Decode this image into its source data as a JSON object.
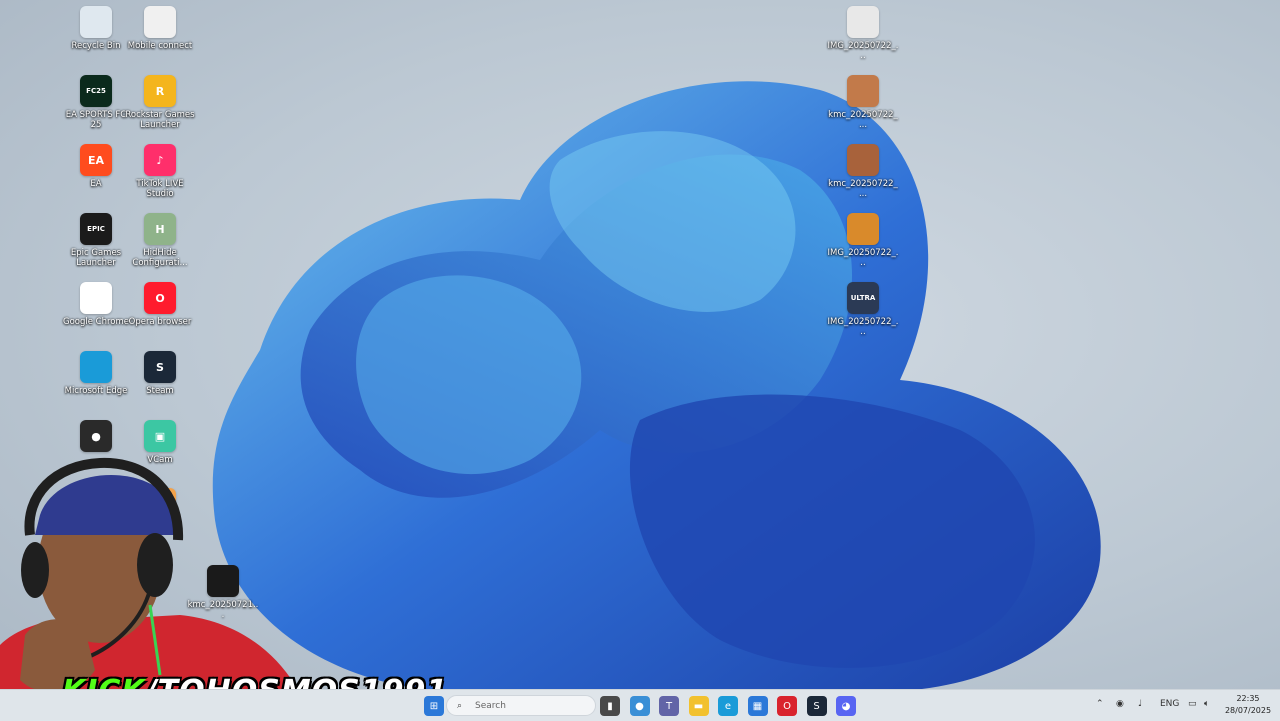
{
  "desktop": {
    "icons_left": [
      {
        "label": "Recycle Bin",
        "icon": "recycle-bin-icon",
        "color": "#dfe8ef"
      },
      {
        "label": "Mobile connect",
        "icon": "document-icon",
        "color": "#f0f0f0"
      },
      {
        "label": "EA SPORTS FC 25",
        "icon": "fc25-icon",
        "color": "#0b2a1c",
        "badge": "FC25"
      },
      {
        "label": "Rockstar Games Launcher",
        "icon": "rockstar-icon",
        "color": "#f4b51d",
        "badge": "R"
      },
      {
        "label": "EA",
        "icon": "ea-icon",
        "color": "#ff4c1e",
        "badge": "EA"
      },
      {
        "label": "TikTok LIVE Studio",
        "icon": "tiktok-live-icon",
        "color": "#ff2f6b",
        "badge": "♪"
      },
      {
        "label": "Epic Games Launcher",
        "icon": "epic-games-icon",
        "color": "#1b1b1b",
        "badge": "EPIC"
      },
      {
        "label": "HidHide Configurati...",
        "icon": "hidhide-icon",
        "color": "#8fb38a",
        "badge": "H"
      },
      {
        "label": "Google Chrome",
        "icon": "chrome-icon",
        "color": "#ffffff"
      },
      {
        "label": "Opera browser",
        "icon": "opera-icon",
        "color": "#ff1b2d",
        "badge": "O"
      },
      {
        "label": "Microsoft Edge",
        "icon": "edge-icon",
        "color": "#1a9bd8"
      },
      {
        "label": "Steam",
        "icon": "steam-icon",
        "color": "#1b2838",
        "badge": "S"
      },
      {
        "label": "",
        "icon": "obs-icon",
        "color": "#2a2a2a",
        "badge": "●"
      },
      {
        "label": "VCam",
        "icon": "vcam-icon",
        "color": "#3cc7a3",
        "badge": "▣"
      },
      {
        "label": "",
        "icon": "app-icon",
        "color": "#f3a24a",
        "badge": "A"
      },
      {
        "label": "kmc_20250721...",
        "icon": "image-file-icon",
        "color": "#1a1a1a"
      }
    ],
    "icons_right": [
      {
        "label": "IMG_20250722_...",
        "icon": "image-file-icon",
        "color": "#e8e8e8"
      },
      {
        "label": "kmc_20250722_...",
        "icon": "image-file-icon",
        "color": "#c27a4a"
      },
      {
        "label": "kmc_20250722_...",
        "icon": "image-file-icon",
        "color": "#a8623b"
      },
      {
        "label": "IMG_20250722_...",
        "icon": "image-file-icon",
        "color": "#d98a2b"
      },
      {
        "label": "IMG_20250722_...",
        "icon": "image-file-icon",
        "color": "#2b3a55",
        "badge": "ULTRA"
      }
    ]
  },
  "taskbar": {
    "search_placeholder": "Search",
    "apps": [
      {
        "name": "task-view-icon",
        "color": "#4a4a4a",
        "glyph": "▮"
      },
      {
        "name": "chrome-icon",
        "color": "#3a8fd6",
        "glyph": "●"
      },
      {
        "name": "teams-icon",
        "color": "#6264a7",
        "glyph": "T"
      },
      {
        "name": "file-explorer-icon",
        "color": "#f2c12e",
        "glyph": "▬"
      },
      {
        "name": "edge-icon",
        "color": "#1a9bd8",
        "glyph": "e"
      },
      {
        "name": "store-icon",
        "color": "#2b78d8",
        "glyph": "▦"
      },
      {
        "name": "opera-icon",
        "color": "#d9232d",
        "glyph": "O"
      },
      {
        "name": "steam-icon",
        "color": "#1b2838",
        "glyph": "S"
      },
      {
        "name": "discord-icon",
        "color": "#5865f2",
        "glyph": "◕"
      }
    ],
    "tray": {
      "language": "ENG",
      "time": "22:35",
      "date": "28/07/2025"
    }
  },
  "stream_overlay": {
    "platform": "KICK",
    "handle": "/TOHOSMOS1991",
    "accent_color": "#53fc18"
  }
}
